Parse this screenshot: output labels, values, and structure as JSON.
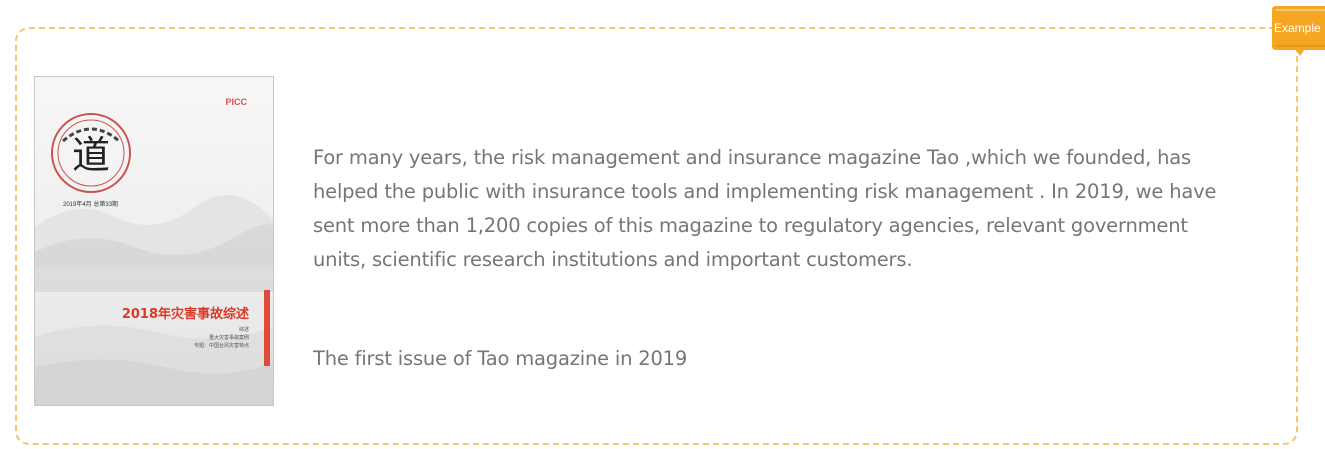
{
  "tag": {
    "label": "Example",
    "color": "#f5a623"
  },
  "cover": {
    "publisher": "PICC",
    "seal_text": "风险管理与保险",
    "seal_glyph": "道",
    "issue_date": "2019年4月 总第33期",
    "title": "2018年灾害事故综述",
    "subtitle_lines": [
      "综述",
      "重大灾害事故案例",
      "专题：中国台风灾害特点"
    ]
  },
  "content": {
    "description": "For many years, the risk management and insurance magazine Tao ,which we founded, has helped the public with insurance tools and implementing risk management . In 2019, we have sent more than 1,200 copies of this magazine to regulatory agencies, relevant government units, scientific research institutions and important customers.",
    "caption": "The first issue of Tao magazine in 2019"
  },
  "colors": {
    "border": "#f6c370",
    "text": "#767676",
    "accent_red": "#d83a2a"
  }
}
